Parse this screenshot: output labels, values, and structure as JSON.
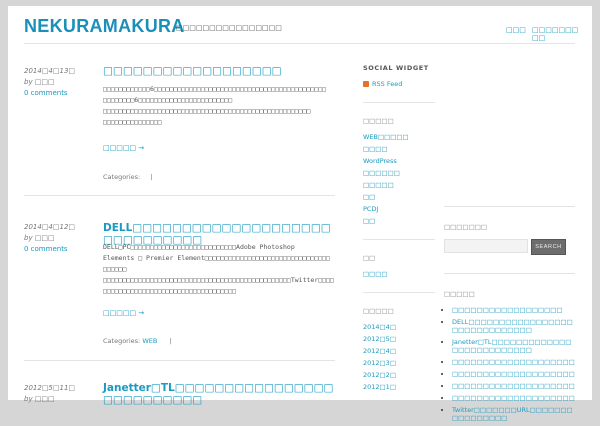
{
  "header": {
    "title": "NEKURAMAKURA",
    "tagline": "□□□□□□□□□□□□□□□□",
    "nav": [
      "□□□",
      "□□□□□□□□□"
    ]
  },
  "posts": [
    {
      "date": "2014□4□13□",
      "author": "by □□□",
      "comments": "0 comments",
      "title": "□□□□□□□□□□□□□□□□□□",
      "body": [
        "□□□□□□□□□□□□6□□□□□□□□□□□□□□□□□□□□□□□□□□□□□□□□□□□□□□□□□□□□",
        "□□□□□□□□6□□□□□□□□□□□□□□□□□□□□□□□□",
        "□□□□□□□□□□□□□□□□□□□□□□□□□□□□□□□□□□□□□□□□□□□□□□□□□□□□□",
        "□□□□□□□□□□□□□□□"
      ],
      "more": "□□□□□ →",
      "categories_label": "Categories:",
      "category": "",
      "sep": "|"
    },
    {
      "date": "2014□4□12□",
      "author": "by □□□",
      "comments": "0 comments",
      "title": "DELL□□□□□□□□□□□□□□□□□□□□□□□□□□□□□□",
      "body": [
        "DELL□PC□□□□□□□□□□□□□□□□□□□□□□□□□□□Adobe Photoshop",
        "Elements □ Premier Element□□□□□□□□□□□□□□□□□□□□□□□□□□□□□□□□",
        "□□□□□□",
        "□□□□□□□□□□□□□□□□□□□□□□□□□□□□□□□□□□□□□□□□□□□□□□□□Twitter□□□□",
        "□□□□□□□□□□□□□□□□□□□□□□□□□□□□□□□□□□"
      ],
      "more": "□□□□□ →",
      "categories_label": "Categories:",
      "category": "WEB",
      "sep": "|"
    },
    {
      "date": "2012□5□11□",
      "author": "by □□□",
      "title": "Janetter□TL□□□□□□□□□□□□□□□□□□□□□□□□□□"
    }
  ],
  "sidebar1": {
    "social_title": "SOCIAL WIDGET",
    "rss": "RSS Feed",
    "cat_title": "□□□□□",
    "categories": [
      "WEB□□□□□",
      "□□□□",
      "WordPress",
      "□□□□□□",
      "□□□□□",
      "□□",
      "PCDJ",
      "□□"
    ],
    "meta_title": "□□",
    "meta_items": [
      "□□□□"
    ],
    "archive_title": "□□□□□",
    "archives": [
      "2014□4□",
      "2012□5□",
      "2012□4□",
      "2012□3□",
      "2012□2□",
      "2012□1□"
    ]
  },
  "sidebar2": {
    "search_title": "□□□□□□□",
    "search_placeholder": "",
    "search_button": "SEARCH",
    "recent_title": "□□□□□",
    "recent": [
      "□□□□□□□□□□□□□□□□□□",
      "DELL□□□□□□□□□□□□□□□□□□□□□□□□□□□□□□",
      "Janetter□TL□□□□□□□□□□□□□□□□□□□□□□□□□□",
      "□□□□□□□□□□□□□□□□□□□□",
      "□□□□□□□□□□□□□□□□□□□□",
      "□□□□□□□□□□□□□□□□□□□□",
      "□□□□□□□□□□□□□□□□□□□□",
      "Twitter□□□□□□□URL□□□□□□□□□□□□□□□□"
    ]
  }
}
